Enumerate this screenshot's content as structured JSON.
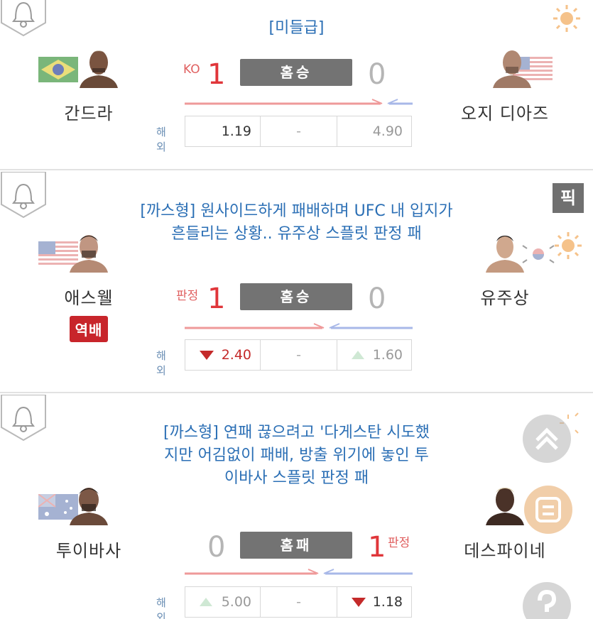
{
  "matches": [
    {
      "headline": "[미들급]",
      "home": {
        "name": "간드라",
        "flag": "brazil-flag"
      },
      "away": {
        "name": "오지 디아즈",
        "flag": "usa-flag"
      },
      "method": "KO",
      "home_score": "1",
      "away_score": "0",
      "result": "홈승",
      "odds_label": "해외",
      "odds": {
        "home": "1.19",
        "draw": "-",
        "away": "4.90"
      }
    },
    {
      "headline": "[까스형] 원사이드하게 패배하며 UFC 내 입지가 흔들리는 상황.. 유주상 스플릿 판정 패",
      "home": {
        "name": "애스웰",
        "flag": "usa-flag",
        "badge": "역배"
      },
      "away": {
        "name": "유주상",
        "flag": "korea-flag"
      },
      "method": "판정",
      "home_score": "1",
      "away_score": "0",
      "result": "홈승",
      "odds_label": "해외",
      "odds": {
        "home": "2.40",
        "draw": "-",
        "away": "1.60"
      },
      "pick_label": "픽"
    },
    {
      "headline": "[까스형] 연패 끊으려고 '다게스탄 시도했지만 어김없이 패배, 방출 위기에 놓인 투이바사 스플릿 판정 패",
      "home": {
        "name": "투이바사",
        "flag": "australia-flag"
      },
      "away": {
        "name": "데스파이네",
        "flag": "usa-flag"
      },
      "method": "판정",
      "home_score": "0",
      "away_score": "1",
      "result": "홈패",
      "odds_label": "해외",
      "odds": {
        "home": "5.00",
        "draw": "-",
        "away": "1.18"
      }
    }
  ],
  "colors": {
    "win": "#e0363a",
    "link": "#2b6fb5",
    "badge": "#c8252b",
    "bar": "#737373"
  },
  "icons": [
    "bell-icon",
    "sun-icon",
    "scroll-top-icon",
    "list-icon",
    "help-icon",
    "arrow-right-icon",
    "arrow-left-icon"
  ]
}
